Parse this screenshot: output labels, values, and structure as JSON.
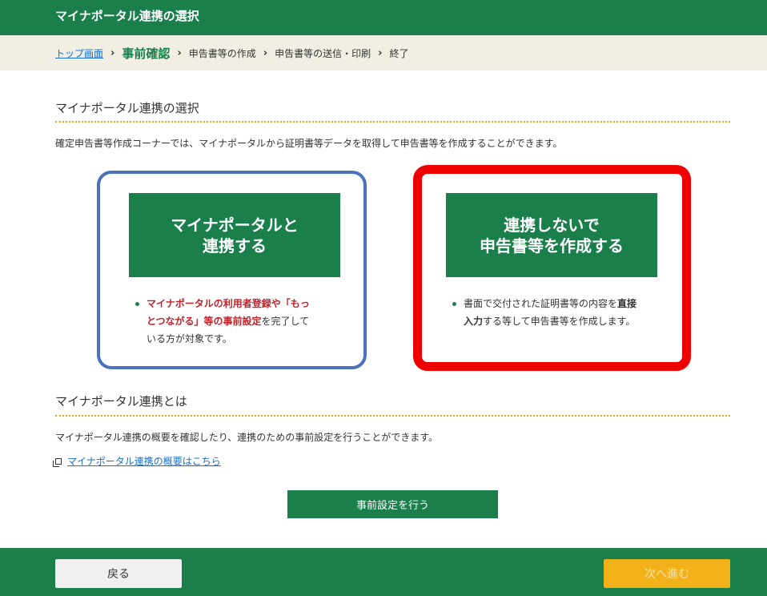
{
  "header": {
    "title": "マイナポータル連携の選択"
  },
  "breadcrumb": {
    "items": [
      "トップ画面",
      "事前確認",
      "申告書等の作成",
      "申告書等の送信・印刷",
      "終了"
    ],
    "separator": "›"
  },
  "section1": {
    "title": "マイナポータル連携の選択",
    "description": "確定申告書等作成コーナーでは、マイナポータルから証明書等データを取得して申告書等を作成することができます。"
  },
  "option_link": {
    "button_label": "マイナポータルと\n連携する",
    "note_part1": "マイナポータルの利用者登録や「もっとつながる」等の事前設定",
    "note_part2": "を完了している方が対象です。"
  },
  "option_nolink": {
    "button_label": "連携しないで\n申告書等を作成する",
    "note_part1": "書面で交付された証明書等の内容を",
    "note_part2": "直接入力",
    "note_part3": "する等して申告書等を作成します。"
  },
  "section2": {
    "title": "マイナポータル連携とは",
    "description": "マイナポータル連携の概要を確認したり、連携のための事前設定を行うことができます。",
    "link_text": "マイナポータル連携の概要はこちら",
    "setup_button": "事前設定を行う"
  },
  "footer": {
    "back_button": "戻る",
    "next_button": "次へ進む"
  },
  "colors": {
    "brand_green": "#1a7f4b",
    "highlight_red": "#ee0000",
    "highlight_blue": "#4a73b8",
    "next_disabled": "#f3b21a"
  }
}
